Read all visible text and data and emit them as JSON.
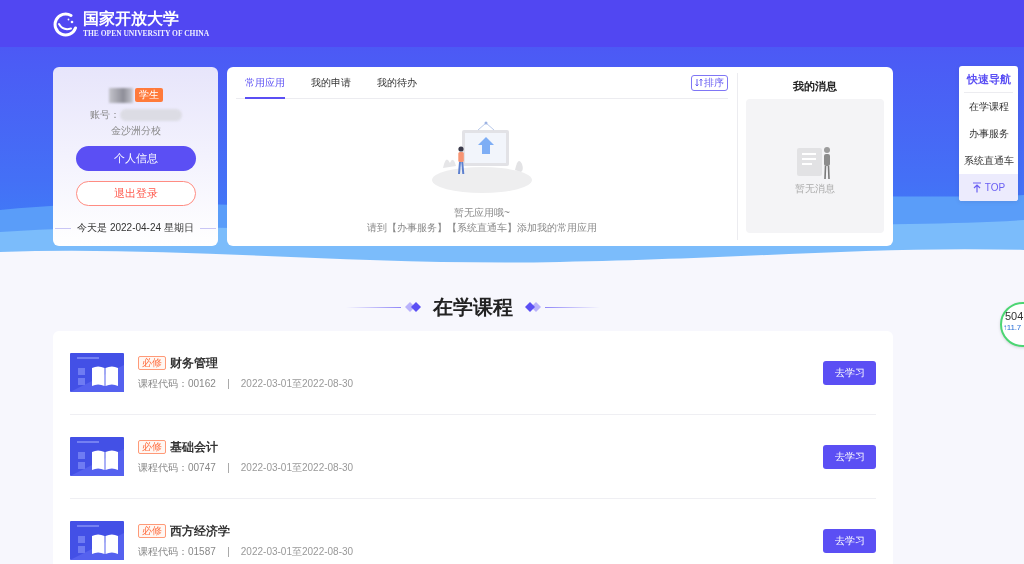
{
  "header": {
    "logo_title": "国家开放大学",
    "logo_subtitle": "THE OPEN UNIVERSITY OF CHINA"
  },
  "profile": {
    "role_tag": "学生",
    "account_label": "账号：",
    "campus": "金沙洲分校",
    "buttons": [
      {
        "label": "个人信息",
        "kind": "primary"
      },
      {
        "label": "退出登录",
        "kind": "outline"
      }
    ],
    "date_line": "今天是 2022-04-24 星期日"
  },
  "apps": {
    "tabs": [
      {
        "label": "常用应用",
        "selected": true
      },
      {
        "label": "我的申请",
        "selected": false
      },
      {
        "label": "我的待办",
        "selected": false
      }
    ],
    "sort_button": "排序",
    "empty_title": "暂无应用哦~",
    "empty_hint": "请到【办事服务】【系统直通车】添加我的常用应用"
  },
  "messages": {
    "title": "我的消息",
    "empty_text": "暂无消息"
  },
  "quick_nav": {
    "title": "快速导航",
    "items": [
      {
        "label": "在学课程"
      },
      {
        "label": "办事服务"
      },
      {
        "label": "系统直通车"
      }
    ],
    "top_button": "TOP"
  },
  "courses": {
    "title": "在学课程",
    "rows": [
      {
        "tag": "必修",
        "name": "财务管理",
        "code": "课程代码：00162",
        "period": "2022-03-01至2022-08-30",
        "button": "去学习"
      },
      {
        "tag": "必修",
        "name": "基础会计",
        "code": "课程代码：00747",
        "period": "2022-03-01至2022-08-30",
        "button": "去学习"
      },
      {
        "tag": "必修",
        "name": "西方经济学",
        "code": "课程代码：01587",
        "period": "2022-03-01至2022-08-30",
        "button": "去学习"
      }
    ]
  },
  "speed_widget": {
    "value": "504",
    "upload": "↑11.7"
  }
}
